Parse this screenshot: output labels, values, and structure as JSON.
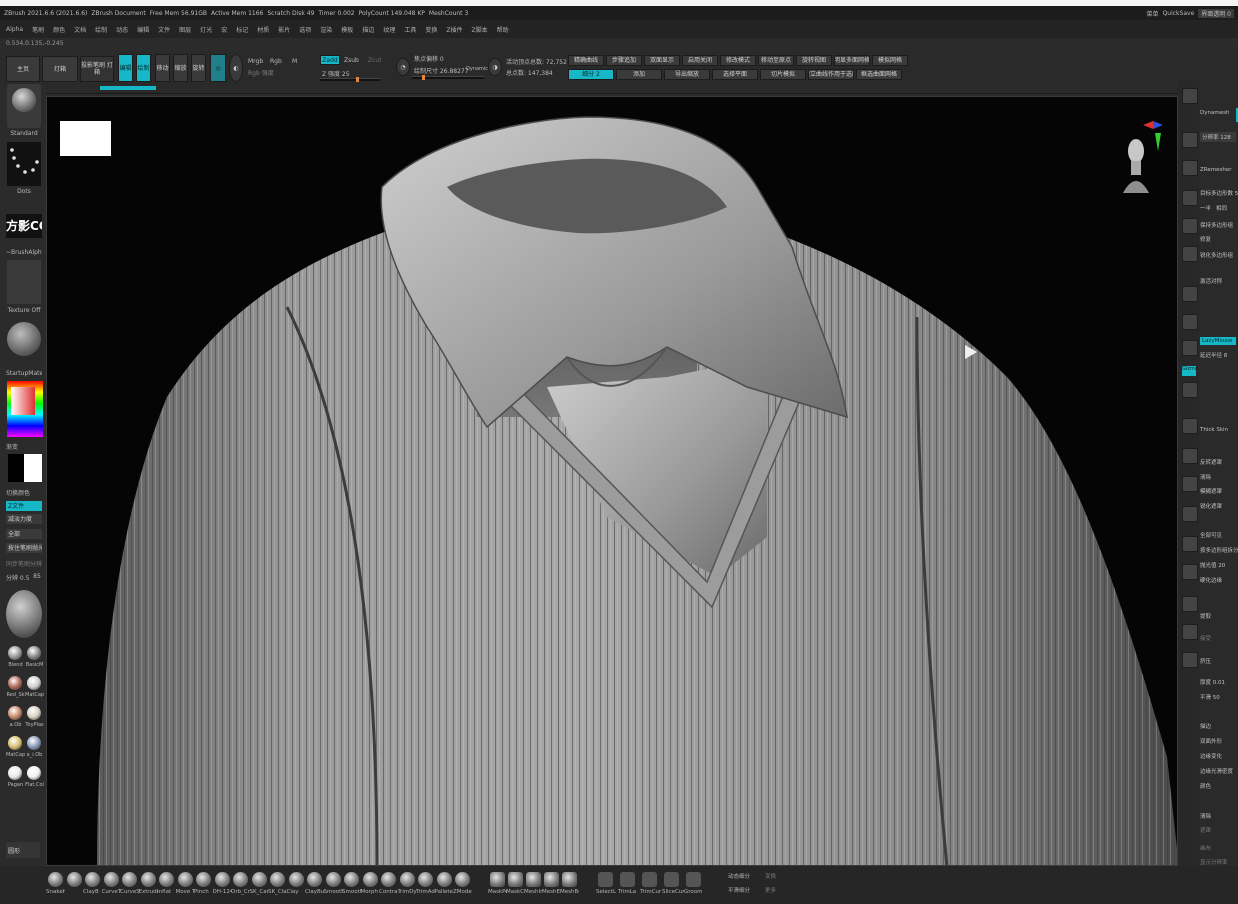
{
  "titlebar": {
    "app": "ZBrush 2021.6.6 (2021.6.6)",
    "document": "ZBrush Document",
    "free_mem": "Free Mem 56.91GB",
    "active_mem": "Active Mem 1166",
    "scratch_disk": "Scratch Disk 49",
    "timer": "Timer 0.002",
    "poly_count": "PolyCount 149.048 KP",
    "mesh_count": "MeshCount 3",
    "right_menu": "菜单",
    "quicksave": "QuickSave",
    "transparency": "界面透明 0"
  },
  "menubar": {
    "items": [
      "Alpha",
      "笔刷",
      "颜色",
      "文档",
      "绘制",
      "动态",
      "编辑",
      "文件",
      "图层",
      "灯光",
      "宏",
      "标记",
      "材质",
      "影片",
      "选项",
      "渲染",
      "模板",
      "描边",
      "纹理",
      "工具",
      "变换",
      "Z插件",
      "Z脚本",
      "帮助"
    ]
  },
  "coords": "0.534,0.135,-0.245",
  "toolbar": {
    "home": "主页",
    "lightbox": "灯箱",
    "projection": "投影笔刷 灯箱",
    "edit": "编辑",
    "draw": "绘制",
    "move": "移动",
    "scale": "缩放",
    "rotate": "旋转",
    "mrgb": "Mrgb",
    "rgb": "Rgb",
    "m": "M",
    "rgb_intensity": "Rgb 强度",
    "zadd": "Zadd",
    "zsub": "Zsub",
    "zcut": "Zcut",
    "z_intensity": "Z 强度 25",
    "focal_shift": "焦点偏移 0",
    "draw_size": "绘制尺寸 26.88277",
    "dynamic": "Dynamic",
    "active_points": "活动顶点总数: 72,752",
    "total_points": "总点数: 147,384",
    "buttons_row1": [
      "精确曲线",
      "步骤追加",
      "双面显示",
      "启用关闭",
      "修改模式",
      "移动至原点",
      "旋转视图",
      "明显多面网格",
      "模拟网格"
    ],
    "buttons_row2": [
      "细分 2",
      "添加",
      "导出缩放",
      "选择平面",
      "切片模拟",
      "建立曲线作用于选区",
      "框选曲面网格"
    ]
  },
  "left": {
    "brush": "Standard",
    "stroke": "Dots",
    "alpha_logo": "方影CG",
    "alpha": "~BrushAlpha",
    "texture": "Texture Off",
    "material": "StartupMaterial",
    "gradient": "渐变",
    "switch_color": "切换颜色",
    "zfile": "Z文件",
    "smoothing": "减淡力度",
    "sculpt_mode": "全部",
    "polish": "按住笔刷抛光",
    "resolution_label": "同步笔刷分辨率",
    "sub_value": "分辨 0.5",
    "sub_num": "85",
    "mat_labels": [
      [
        "Blend",
        "BasicM"
      ],
      [
        "Red_Sk",
        "MatCap"
      ],
      [
        "a.Ob",
        "ToyPlas"
      ],
      [
        "MatCap",
        "a_i.Ob"
      ],
      [
        "Pagan",
        "Flat.Col"
      ]
    ],
    "bottom_label": "圆形"
  },
  "viewport": {
    "marker_color": "#ffffff"
  },
  "right": {
    "dynamesh": "Dynamesh",
    "resolution": "分辨率 128",
    "zremesher": "ZRemesher",
    "target_polys": "目标多边形数 5",
    "half": "一半",
    "adapt": "相同",
    "keep_groups": "保持多边形组",
    "fix": "修复",
    "sharp": "锐化多边形组",
    "draw_ids": "激活对称",
    "lazy": "LazyMouse",
    "lazy_radius": "延迟半径 8",
    "gizmo": "Gizmo",
    "thick": "Thick Skin",
    "invert": "反转遮罩",
    "clear": "清除",
    "blur": "模糊遮罩",
    "sharpen": "锐化遮罩",
    "group_visible": "全部可见",
    "group_split": "按多边形组拆分子工具",
    "polish_value": "抛光值 20",
    "crisp": "硬化边缘",
    "extract": "提取",
    "accept": "接受",
    "bevel": "挤压",
    "thickness": "厚度 0.01",
    "smoothing": "平滑 50",
    "edge": "描边",
    "dual": "双面外形",
    "tcorner": "边缘变化",
    "tborder": "边缘光滑密度",
    "color": "颜色",
    "bottom1": "清除",
    "bottom2": "遮罩",
    "bottom3": "画布",
    "bottom4": "显示分辨率"
  },
  "bottom": {
    "brushes": [
      "SnakeH",
      "",
      "ClayB",
      "CurveT",
      "CurveS",
      "Extrude",
      "Inflat",
      "Move T",
      "Pinch",
      "DH-124",
      "Orb_Cr",
      "SK_Car",
      "SK_Clay",
      "Clay",
      "ClayBu",
      "Smooth",
      "Smooth",
      "Morph",
      "Contrac",
      "TrimDyn",
      "TrimAd",
      "Pallete",
      "ZModel"
    ],
    "group2": [
      "MaskPen",
      "MaskCur",
      "MeshIns",
      "MeshExt",
      "MeshBo"
    ],
    "group3": [
      "SelectL",
      "TrimLa",
      "TrimCur",
      "SliceCur",
      "Groom"
    ],
    "info1": "动态细分",
    "info2": "平滑细分",
    "info3": "变换",
    "info4": "更多"
  }
}
